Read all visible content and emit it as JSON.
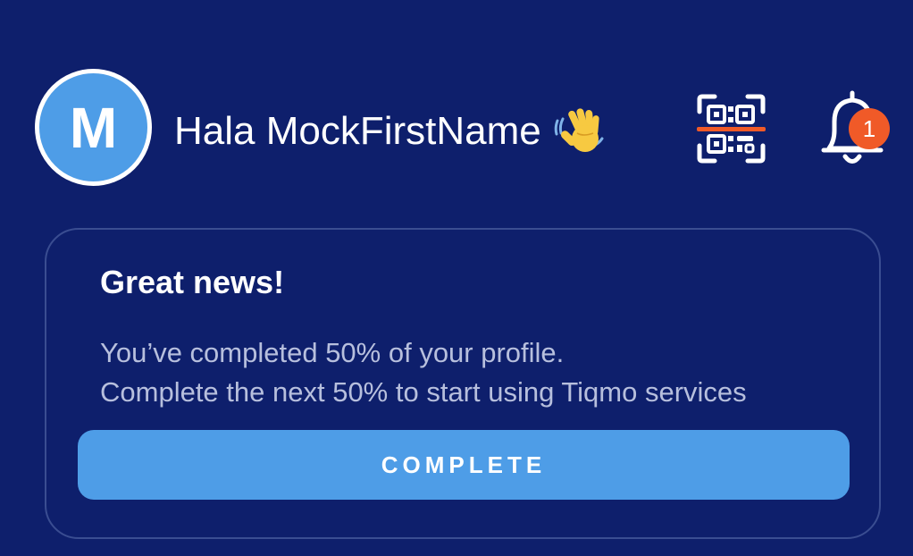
{
  "colors": {
    "background": "#0e1f6c",
    "accent": "#4e9de7",
    "badge": "#f05a28",
    "card_border": "#3a4d91",
    "muted_text": "#b7bfdd",
    "qr_scan_line": "#f05a28"
  },
  "header": {
    "avatar_initial": "M",
    "greeting": "Hala MockFirstName",
    "greeting_icon": "waving-hand-icon",
    "qr_icon": "qr-code-scan-icon",
    "bell_icon": "bell-icon",
    "notification_count": "1"
  },
  "profile_card": {
    "title": "Great news!",
    "line1": "You’ve completed 50% of your profile.",
    "line2": "Complete the next 50% to start using Tiqmo services",
    "button_label": "COMPLETE"
  }
}
